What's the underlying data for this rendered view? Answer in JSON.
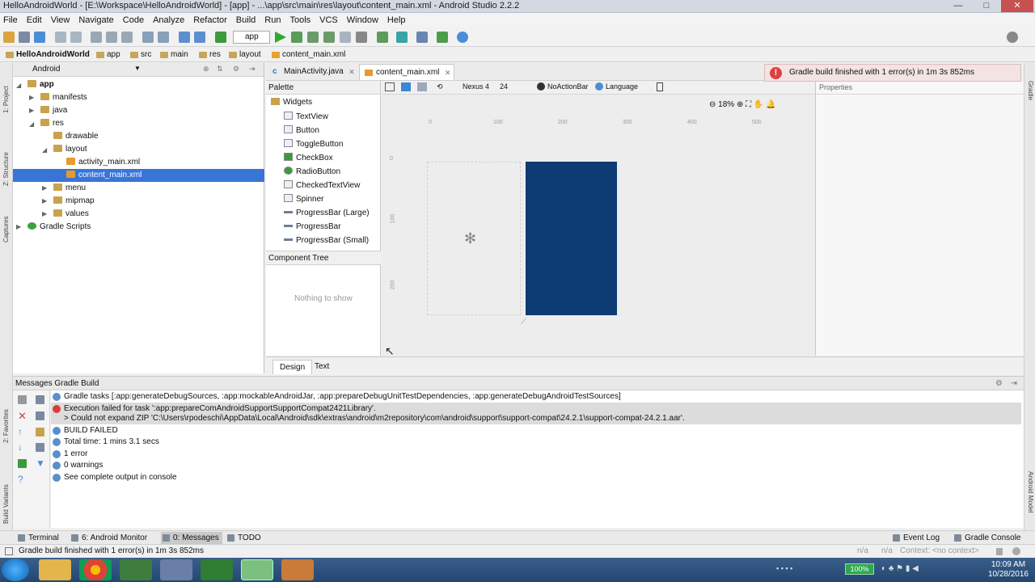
{
  "window": {
    "title": "HelloAndroidWorld - [E:\\Workspace\\HelloAndroidWorld] - [app] - ...\\app\\src\\main\\res\\layout\\content_main.xml - Android Studio 2.2.2",
    "minimize": "—",
    "maximize": "□",
    "close": "✕"
  },
  "menu": [
    "File",
    "Edit",
    "View",
    "Navigate",
    "Code",
    "Analyze",
    "Refactor",
    "Build",
    "Run",
    "Tools",
    "VCS",
    "Window",
    "Help"
  ],
  "toolbar": {
    "run_config": "app"
  },
  "breadcrumb": [
    "HelloAndroidWorld",
    "app",
    "src",
    "main",
    "res",
    "layout",
    "content_main.xml"
  ],
  "side_tools": {
    "project": "1: Project",
    "structure": "Z: Structure",
    "captures": "Captures",
    "favorites": "2: Favorites",
    "build_variants": "Build Variants",
    "gradle": "Gradle",
    "android_model": "Android Model"
  },
  "project": {
    "view_mode": "Android",
    "tree": [
      {
        "label": "app",
        "level": 0,
        "icon": "folder-icon",
        "expanded": true
      },
      {
        "label": "manifests",
        "level": 1,
        "icon": "folder-icon",
        "expanded": false
      },
      {
        "label": "java",
        "level": 1,
        "icon": "folder-icon",
        "expanded": false
      },
      {
        "label": "res",
        "level": 1,
        "icon": "folder-icon",
        "expanded": true
      },
      {
        "label": "drawable",
        "level": 2,
        "icon": "folder-icon"
      },
      {
        "label": "layout",
        "level": 2,
        "icon": "folder-icon",
        "expanded": true
      },
      {
        "label": "activity_main.xml",
        "level": 3,
        "icon": "xml-icon"
      },
      {
        "label": "content_main.xml",
        "level": 3,
        "icon": "xml-icon",
        "selected": true
      },
      {
        "label": "menu",
        "level": 2,
        "icon": "folder-icon",
        "expanded": false
      },
      {
        "label": "mipmap",
        "level": 2,
        "icon": "folder-icon",
        "expanded": false
      },
      {
        "label": "values",
        "level": 2,
        "icon": "folder-icon",
        "expanded": false
      },
      {
        "label": "Gradle Scripts",
        "level": 0,
        "icon": "gradle-icon",
        "expanded": false
      }
    ]
  },
  "editor_tabs": [
    {
      "label": "MainActivity.java",
      "active": false
    },
    {
      "label": "content_main.xml",
      "active": true
    }
  ],
  "palette": {
    "title": "Palette",
    "group": "Widgets",
    "items": [
      "TextView",
      "Button",
      "ToggleButton",
      "CheckBox",
      "RadioButton",
      "CheckedTextView",
      "Spinner",
      "ProgressBar (Large)",
      "ProgressBar",
      "ProgressBar (Small)"
    ]
  },
  "component_tree": {
    "title": "Component Tree",
    "empty_text": "Nothing to show"
  },
  "design_toolbar": {
    "device": "Nexus 4",
    "api": "24",
    "theme": "NoActionBar",
    "language": "Language"
  },
  "canvas": {
    "zoom": "18%",
    "ruler_top": [
      "0",
      "100",
      "200",
      "300",
      "400",
      "500"
    ],
    "ruler_left": [
      "0",
      "100",
      "200"
    ]
  },
  "properties": {
    "title": "Properties"
  },
  "notification": {
    "text": "Gradle build finished with 1 error(s) in 1m 3s 852ms",
    "icon": "!"
  },
  "design_tabs": [
    {
      "label": "Design",
      "active": true
    },
    {
      "label": "Text",
      "active": false
    }
  ],
  "messages": {
    "title": "Messages Gradle Build",
    "lines": [
      {
        "type": "info",
        "text": "Gradle tasks [:app:generateDebugSources, :app:mockableAndroidJar, :app:prepareDebugUnitTestDependencies, :app:generateDebugAndroidTestSources]"
      },
      {
        "type": "error",
        "text": "Execution failed for task ':app:prepareComAndroidSupportSupportCompat2421Library'."
      },
      {
        "type": "detail",
        "text": "> Could not expand ZIP 'C:\\Users\\rpodeschi\\AppData\\Local\\Android\\sdk\\extras\\android\\m2repository\\com\\android\\support\\support-compat\\24.2.1\\support-compat-24.2.1.aar'."
      },
      {
        "type": "info",
        "text": "BUILD FAILED"
      },
      {
        "type": "info",
        "text": "Total time: 1 mins 3.1 secs"
      },
      {
        "type": "info",
        "text": "1 error"
      },
      {
        "type": "info",
        "text": "0 warnings"
      },
      {
        "type": "info",
        "text": "See complete output in console"
      }
    ]
  },
  "bottom_tabs": [
    {
      "label": "Terminal",
      "active": false
    },
    {
      "label": "6: Android Monitor",
      "active": false
    },
    {
      "label": "0: Messages",
      "active": true
    },
    {
      "label": "TODO",
      "active": false
    }
  ],
  "bottom_right_tabs": [
    "Event Log",
    "Gradle Console"
  ],
  "status": {
    "text": "Gradle build finished with 1 error(s) in 1m 3s 852ms",
    "position": "n/a",
    "context": "n/a",
    "context_label": "Context: <no context>"
  },
  "taskbar": {
    "battery": "100%",
    "time": "10:09 AM",
    "date": "10/28/2016"
  },
  "colors": {
    "device_screen": "#0d3b73",
    "selection": "#3875d7",
    "error": "#d93c3c"
  }
}
